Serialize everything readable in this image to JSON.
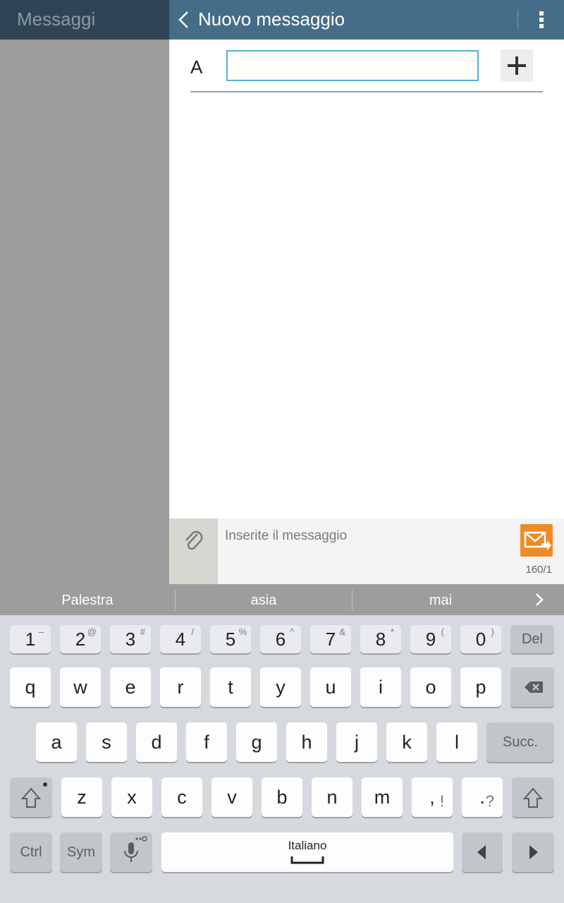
{
  "sidebar": {
    "title": "Messaggi"
  },
  "header": {
    "title": "Nuovo messaggio",
    "back_icon": "chevron-left-icon",
    "menu_icon": "overflow-menu-icon"
  },
  "recipient": {
    "label": "A",
    "value": "",
    "placeholder": ""
  },
  "compose": {
    "placeholder": "Inserite il messaggio",
    "counter": "160/1",
    "send_color": "#f08a24"
  },
  "suggestions": [
    "Palestra",
    "asia",
    "mai"
  ],
  "keyboard": {
    "number_row": [
      {
        "main": "1",
        "sup": "–"
      },
      {
        "main": "2",
        "sup": "@"
      },
      {
        "main": "3",
        "sup": "#"
      },
      {
        "main": "4",
        "sup": "/"
      },
      {
        "main": "5",
        "sup": "%"
      },
      {
        "main": "6",
        "sup": "^"
      },
      {
        "main": "7",
        "sup": "&"
      },
      {
        "main": "8",
        "sup": "*"
      },
      {
        "main": "9",
        "sup": "("
      },
      {
        "main": "0",
        "sup": ")"
      }
    ],
    "del": "Del",
    "row1": [
      "q",
      "w",
      "e",
      "r",
      "t",
      "y",
      "u",
      "i",
      "o",
      "p"
    ],
    "row2": [
      "a",
      "s",
      "d",
      "f",
      "g",
      "h",
      "j",
      "k",
      "l"
    ],
    "enter": "Succ.",
    "row3": [
      "z",
      "x",
      "c",
      "v",
      "b",
      "n",
      "m"
    ],
    "comma": {
      "main": ",",
      "sup": "!"
    },
    "period": {
      "main": ".",
      "sup": "?"
    },
    "ctrl": "Ctrl",
    "sym": "Sym",
    "space_label": "Italiano"
  }
}
